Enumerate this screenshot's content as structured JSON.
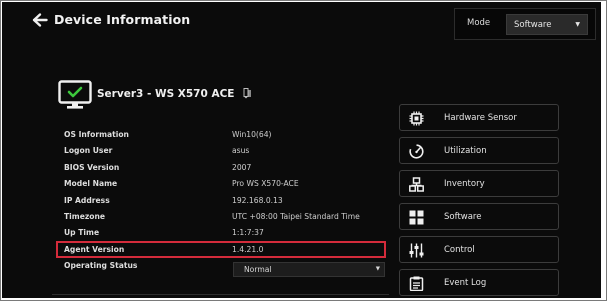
{
  "header": {
    "title": "Device Information",
    "back_icon": "arrow-left-icon"
  },
  "mode": {
    "label": "Mode",
    "selected": "Software"
  },
  "device": {
    "name": "Server3 - WS X570 ACE",
    "icon": "monitor-check-icon",
    "edit_icon": "pencil-icon"
  },
  "info": {
    "rows": [
      {
        "key": "OS Information",
        "value": "Win10(64)"
      },
      {
        "key": "Logon User",
        "value": "asus"
      },
      {
        "key": "BIOS Version",
        "value": "2007"
      },
      {
        "key": "Model Name",
        "value": "Pro WS X570-ACE"
      },
      {
        "key": "IP Address",
        "value": "192.168.0.13"
      },
      {
        "key": "Timezone",
        "value": "UTC +08:00 Taipei Standard Time"
      },
      {
        "key": "Up Time",
        "value": "1:1:7:37"
      },
      {
        "key": "Agent Version",
        "value": "1.4.21.0"
      }
    ],
    "status": {
      "key": "Operating Status",
      "value": "Normal"
    }
  },
  "nav": [
    {
      "label": "Hardware Sensor",
      "icon": "chip-icon"
    },
    {
      "label": "Utilization",
      "icon": "gauge-icon"
    },
    {
      "label": "Inventory",
      "icon": "inventory-icon"
    },
    {
      "label": "Software",
      "icon": "grid-icon"
    },
    {
      "label": "Control",
      "icon": "sliders-icon"
    },
    {
      "label": "Event Log",
      "icon": "clipboard-icon"
    }
  ],
  "colors": {
    "background": "#0b0b0b",
    "highlight": "#d42b3b",
    "check_green": "#3cc83c"
  }
}
